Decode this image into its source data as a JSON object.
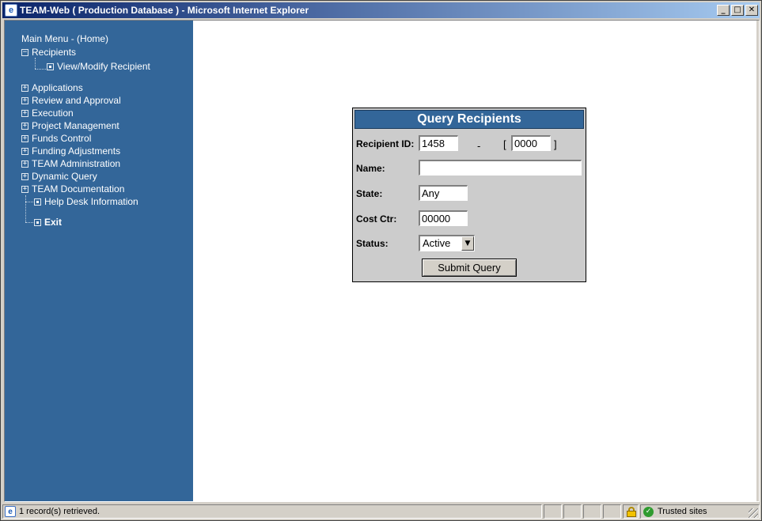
{
  "window": {
    "title": "TEAM-Web ( Production Database ) - Microsoft Internet Explorer",
    "buttons": {
      "minimize": "_",
      "maximize": "□",
      "close": "✕"
    }
  },
  "sidebar": {
    "home": "Main Menu - (Home)",
    "recipients": {
      "label": "Recipients",
      "toggle": "−",
      "child": "View/Modify Recipient"
    },
    "items": [
      {
        "label": "Applications",
        "toggle": "+"
      },
      {
        "label": "Review and Approval",
        "toggle": "+"
      },
      {
        "label": "Execution",
        "toggle": "+"
      },
      {
        "label": "Project Management",
        "toggle": "+"
      },
      {
        "label": "Funds Control",
        "toggle": "+"
      },
      {
        "label": "Funding Adjustments",
        "toggle": "+"
      },
      {
        "label": "TEAM Administration",
        "toggle": "+"
      },
      {
        "label": "Dynamic Query",
        "toggle": "+"
      },
      {
        "label": "TEAM Documentation",
        "toggle": "+"
      }
    ],
    "help_desk": "Help Desk Information",
    "exit": "Exit"
  },
  "query": {
    "title": "Query Recipients",
    "recipient_id_label": "Recipient ID:",
    "recipient_id_value": "1458",
    "dash": "-",
    "bracket_open": "[",
    "bracket_close": "]",
    "suffix_value": "0000",
    "name_label": "Name:",
    "name_value": "",
    "state_label": "State:",
    "state_value": "Any",
    "cost_ctr_label": "Cost Ctr:",
    "cost_ctr_value": "00000",
    "status_label": "Status:",
    "status_value": "Active",
    "submit_label": "Submit Query"
  },
  "statusbar": {
    "message": "1 record(s) retrieved.",
    "zone": "Trusted sites"
  }
}
